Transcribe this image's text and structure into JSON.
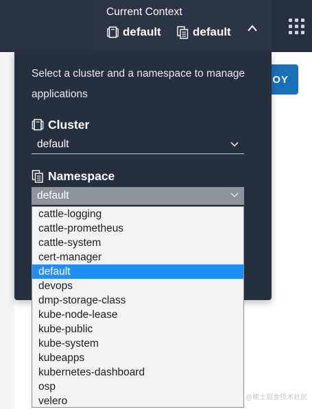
{
  "header": {
    "context_title": "Current Context",
    "cluster_value": "default",
    "namespace_value": "default"
  },
  "page": {
    "deploy_button_partial": "OY"
  },
  "panel": {
    "description": "Select a cluster and a namespace to manage applications",
    "cluster_label": "Cluster",
    "cluster_selected": "default",
    "namespace_label": "Namespace",
    "namespace_selected": "default"
  },
  "namespace_options": [
    "cattle-logging",
    "cattle-prometheus",
    "cattle-system",
    "cert-manager",
    "default",
    "devops",
    "dmp-storage-class",
    "kube-node-lease",
    "kube-public",
    "kube-system",
    "kubeapps",
    "kubernetes-dashboard",
    "osp",
    "velero"
  ],
  "selected_namespace_index": 4,
  "watermark": "@稀土掘金技术社区",
  "colors": {
    "header_bg": "#29323f",
    "panel_bg": "#262f3d",
    "accent_button": "#1a70b8",
    "selected_option": "#1e8fff"
  }
}
